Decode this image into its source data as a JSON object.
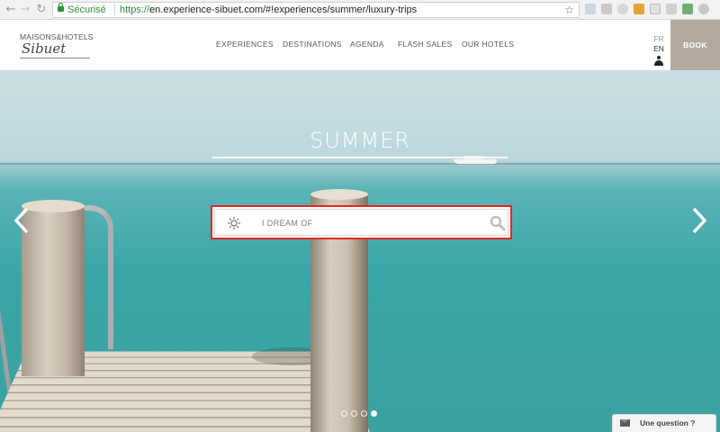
{
  "browser": {
    "secure_label": "Sécurisé",
    "url_scheme": "https://",
    "url_rest": "en.experience-sibuet.com/#!experiences/summer/luxury-trips"
  },
  "header": {
    "logo_top": "MAISONS&HOTELS",
    "logo_script": "Sibuet",
    "nav": [
      "EXPERIENCES",
      "DESTINATIONS",
      "AGENDA",
      "FLASH SALES",
      "OUR HOTELS"
    ],
    "lang_fr": "FR",
    "lang_en": "EN",
    "book_label": "BOOK"
  },
  "hero": {
    "title": "SUMMER",
    "search_placeholder": "I DREAM OF",
    "search_value": "",
    "carousel_total": 4,
    "carousel_active_index": 3
  },
  "chat": {
    "label": "Une question ?"
  },
  "icons": {
    "season": "sun-icon",
    "search": "search-icon",
    "prev": "chevron-left-icon",
    "next": "chevron-right-icon",
    "user": "user-icon",
    "chat": "envelope-icon"
  },
  "colors": {
    "book_bg": "#b3a99e",
    "highlight_border": "#e8261f",
    "secure_green": "#2f8f3a"
  }
}
